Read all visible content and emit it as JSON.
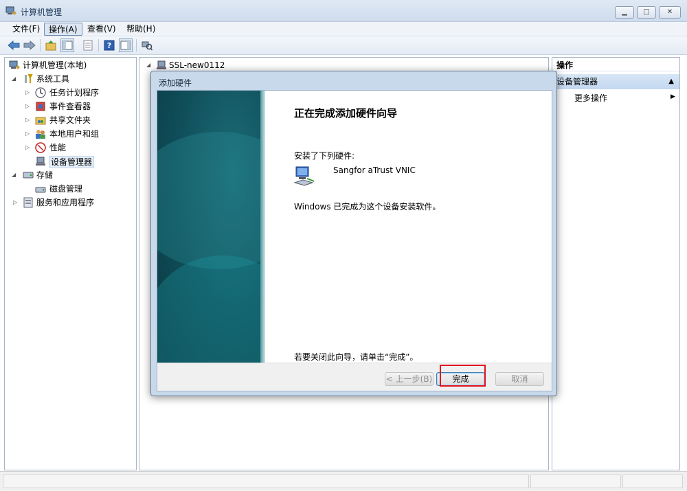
{
  "window": {
    "title": "计算机管理",
    "min": "▁",
    "max": "□",
    "close": "✕"
  },
  "menu": [
    "文件(F)",
    "操作(A)",
    "查看(V)",
    "帮助(H)"
  ],
  "tree": {
    "root": "计算机管理(本地)",
    "system_tools": "系统工具",
    "task_scheduler": "任务计划程序",
    "event_viewer": "事件查看器",
    "shared_folders": "共享文件夹",
    "local_users": "本地用户和组",
    "performance": "性能",
    "device_manager": "设备管理器",
    "storage": "存储",
    "disk_management": "磁盘管理",
    "services": "服务和应用程序"
  },
  "center": {
    "computer_node": "SSL-new0112"
  },
  "actions": {
    "header": "操作",
    "section": "设备管理器",
    "more": "更多操作"
  },
  "dialog": {
    "title": "添加硬件",
    "heading": "正在完成添加硬件向导",
    "installed_label": "安装了下列硬件:",
    "device_name": "Sangfor aTrust VNIC",
    "completed_msg": "Windows 已完成为这个设备安装软件。",
    "close_hint": "若要关闭此向导，请单击“完成”。",
    "back_button": "< 上一步(B)",
    "finish_button": "完成",
    "cancel_button": "取消"
  },
  "colors": {
    "highlight": "#e0141e",
    "banner": "#0f4d58"
  }
}
